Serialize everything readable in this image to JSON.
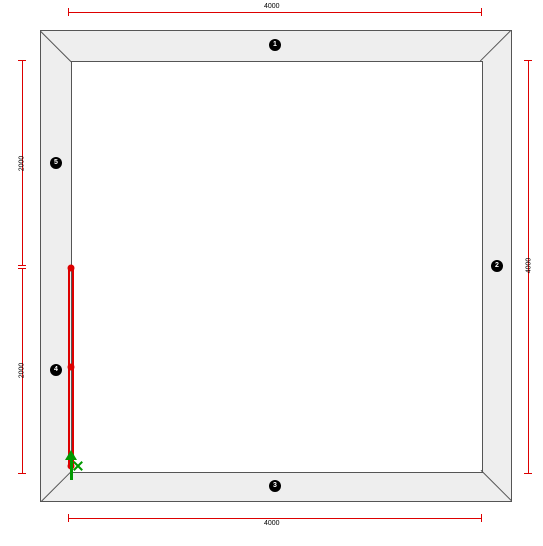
{
  "dimensions": {
    "top_outer": "4000",
    "right_outer": "4000",
    "bottom_outer": "4000",
    "left_upper": "2000",
    "left_lower": "2000"
  },
  "markers": {
    "m1": "1",
    "m2": "2",
    "m3": "3",
    "m4": "4",
    "m5": "5"
  }
}
